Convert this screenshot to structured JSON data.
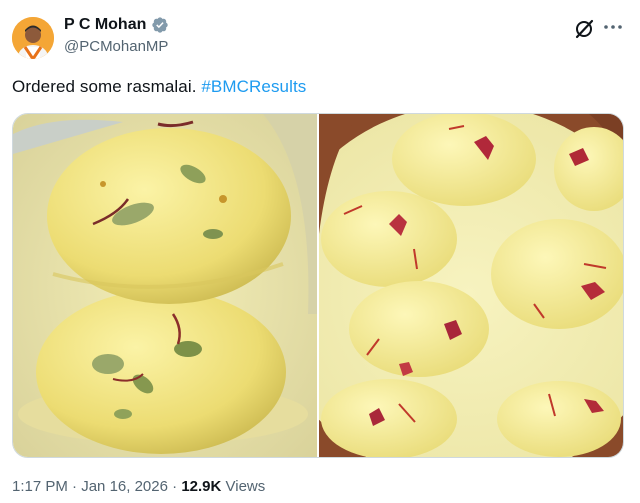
{
  "author": {
    "name": "P C Mohan",
    "handle": "@PCMohanMP",
    "verified_color": "#829aab"
  },
  "tweet": {
    "text": "Ordered some rasmalai. ",
    "hashtag": "#BMCResults",
    "hashtag_color": "#1d9bf0"
  },
  "media": {
    "photos": [
      "rasmalai-closeup-photo",
      "rasmalai-bowl-photo"
    ]
  },
  "meta": {
    "time": "1:17 PM",
    "sep1": " · ",
    "date": "Jan 16, 2026",
    "sep2": " · ",
    "views_count": "12.9K",
    "views_label": " Views"
  },
  "icons": {
    "verified": "verified-badge-icon",
    "grok": "grok-icon",
    "more": "more-options-icon"
  }
}
